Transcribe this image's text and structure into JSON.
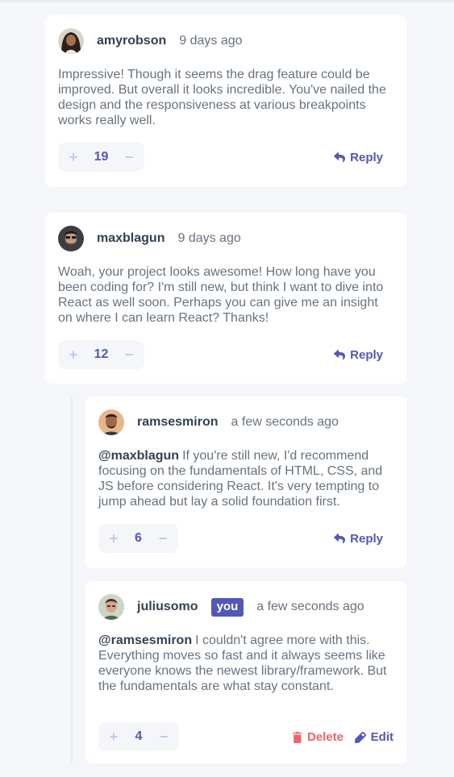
{
  "comments": [
    {
      "username": "amyrobson",
      "date": "9 days ago",
      "text": "Impressive! Though it seems the drag feature could be improved. But overall it looks incredible. You've nailed the design and the responsiveness at various breakpoints works really well.",
      "score": "19",
      "action": "Reply"
    },
    {
      "username": "maxblagun",
      "date": "9 days ago",
      "text": "Woah, your project looks awesome! How long have you been coding for? I'm still new, but think I want to dive into React as well soon. Perhaps you can give me an insight on where I can learn React? Thanks!",
      "score": "12",
      "action": "Reply"
    },
    {
      "username": "ramsesmiron",
      "date": "a few seconds ago",
      "mention": "@maxblagun",
      "text": "If you're still new, I'd recommend focusing on the fundamentals of HTML, CSS, and JS before considering React. It's very tempting to jump ahead but lay a solid foundation first.",
      "score": "6",
      "action": "Reply"
    },
    {
      "username": "juliusomo",
      "badge": "you",
      "date": "a few seconds ago",
      "mention": "@ramsesmiron",
      "text": "I couldn't agree more with this. Everything moves so fast and it always seems like everyone knows the newest library/framework. But the fundamentals are what stay constant.",
      "score": "4",
      "delete_label": "Delete",
      "edit_label": "Edit"
    }
  ],
  "score_controls": {
    "plus": "+",
    "minus": "−"
  },
  "colors": {
    "background": "#f5f6fa",
    "card": "#ffffff",
    "moderate_blue": "#5357b6",
    "light_grayish_blue": "#c5c6ef",
    "soft_red": "#ed6468",
    "dark_blue": "#324152",
    "grayish_blue": "#67727e"
  },
  "icons": {
    "reply": "reply-arrow-icon",
    "delete": "trash-icon",
    "edit": "pencil-icon"
  }
}
